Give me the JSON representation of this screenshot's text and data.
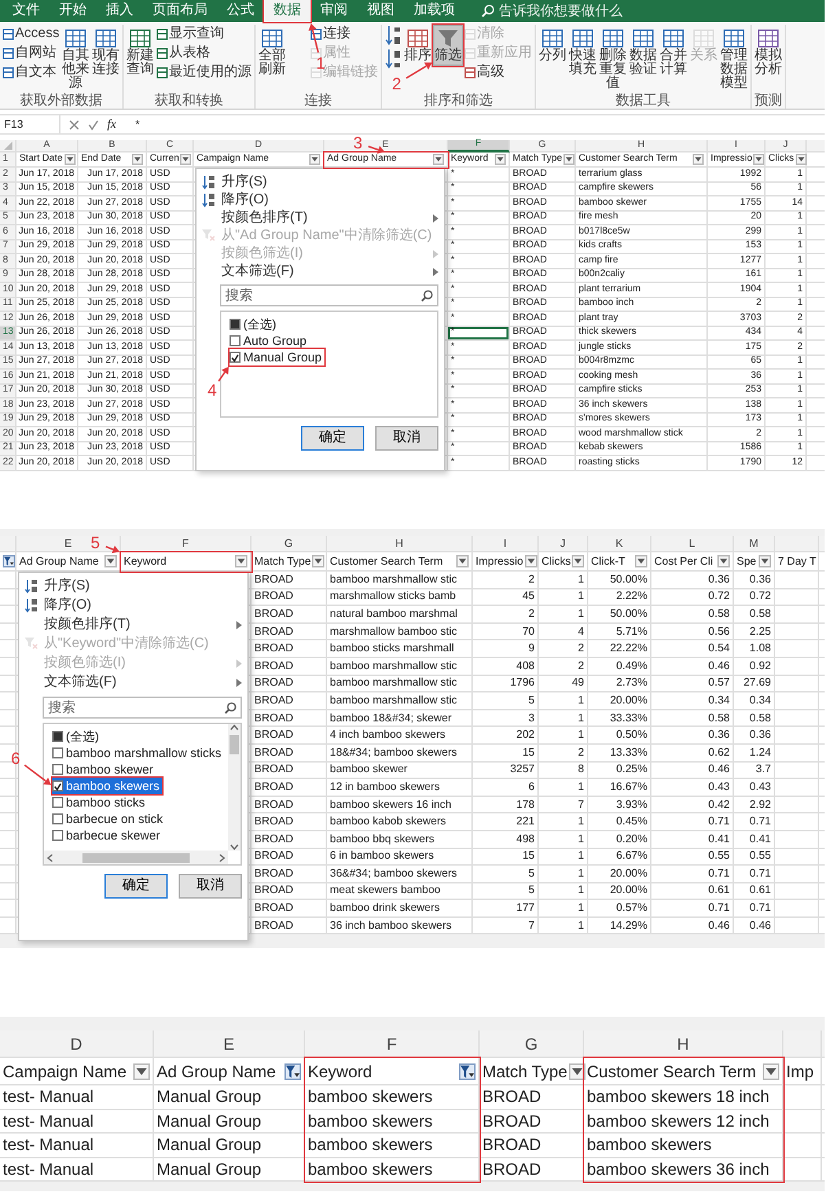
{
  "screenshot_1": {
    "ribbon_tabs": [
      {
        "label": "文件",
        "selected": false,
        "marked": false
      },
      {
        "label": "开始",
        "selected": false,
        "marked": false
      },
      {
        "label": "插入",
        "selected": false,
        "marked": false
      },
      {
        "label": "页面布局",
        "selected": false,
        "marked": false
      },
      {
        "label": "公式",
        "selected": false,
        "marked": false
      },
      {
        "label": "数据",
        "selected": true,
        "marked": true
      },
      {
        "label": "审阅",
        "selected": false,
        "marked": false
      },
      {
        "label": "视图",
        "selected": false,
        "marked": false
      },
      {
        "label": "加载项",
        "selected": false,
        "marked": false
      }
    ],
    "tell_me": "告诉我你想要做什么",
    "ribbon_groups": [
      {
        "label": "获取外部数据",
        "commands": [
          {
            "label": "Access",
            "kind": "small",
            "disabled": false,
            "selected": false,
            "marked": false
          },
          {
            "label": "自网站",
            "kind": "small",
            "disabled": false,
            "selected": false,
            "marked": false
          },
          {
            "label": "自文本",
            "kind": "small",
            "disabled": false,
            "selected": false,
            "marked": false
          },
          {
            "label": "自其他来源",
            "kind": "large",
            "disabled": false,
            "selected": false,
            "marked": false
          },
          {
            "label": "现有连接",
            "kind": "large",
            "disabled": false,
            "selected": false,
            "marked": false
          }
        ]
      },
      {
        "label": "获取和转换",
        "commands": [
          {
            "label": "新建查询",
            "kind": "large",
            "disabled": false,
            "selected": false,
            "marked": false
          },
          {
            "label": "显示查询",
            "kind": "small",
            "disabled": false,
            "selected": false,
            "marked": false
          },
          {
            "label": "从表格",
            "kind": "small",
            "disabled": false,
            "selected": false,
            "marked": false
          },
          {
            "label": "最近使用的源",
            "kind": "small",
            "disabled": false,
            "selected": false,
            "marked": false
          }
        ]
      },
      {
        "label": "连接",
        "commands": [
          {
            "label": "全部刷新",
            "kind": "large",
            "disabled": false,
            "selected": false,
            "marked": false
          },
          {
            "label": "连接",
            "kind": "small",
            "disabled": false,
            "selected": false,
            "marked": false
          },
          {
            "label": "属性",
            "kind": "small",
            "disabled": true,
            "selected": false,
            "marked": false
          },
          {
            "label": "编辑链接",
            "kind": "small",
            "disabled": true,
            "selected": false,
            "marked": false
          }
        ]
      },
      {
        "label": "排序和筛选",
        "commands": [
          {
            "kind": "sort-ascending",
            "disabled": false,
            "selected": false,
            "marked": false
          },
          {
            "kind": "sort-descending",
            "disabled": false,
            "selected": false,
            "marked": false
          },
          {
            "label": "排序",
            "kind": "large",
            "disabled": false,
            "selected": false,
            "marked": false
          },
          {
            "label": "筛选",
            "kind": "filter",
            "disabled": false,
            "selected": true,
            "marked": true
          },
          {
            "label": "清除",
            "kind": "small",
            "disabled": true,
            "selected": false,
            "marked": false
          },
          {
            "label": "重新应用",
            "kind": "small",
            "disabled": true,
            "selected": false,
            "marked": false
          },
          {
            "label": "高级",
            "kind": "small",
            "disabled": false,
            "selected": false,
            "marked": false
          }
        ]
      },
      {
        "label": "数据工具",
        "commands": [
          {
            "label": "分列",
            "kind": "large",
            "disabled": false,
            "selected": false,
            "marked": false
          },
          {
            "label": "快速填充",
            "kind": "large",
            "disabled": false,
            "selected": false,
            "marked": false
          },
          {
            "label": "删除重复值",
            "kind": "large",
            "disabled": false,
            "selected": false,
            "marked": false
          },
          {
            "label": "数据验证",
            "kind": "large",
            "disabled": false,
            "selected": false,
            "marked": false
          },
          {
            "label": "合并计算",
            "kind": "large",
            "disabled": false,
            "selected": false,
            "marked": false
          },
          {
            "label": "关系",
            "kind": "large",
            "disabled": true,
            "selected": false,
            "marked": false
          },
          {
            "label": "管理数据模型",
            "kind": "large",
            "disabled": false,
            "selected": false,
            "marked": false
          }
        ]
      },
      {
        "label": "预测",
        "commands": [
          {
            "label": "模拟分析",
            "kind": "large",
            "disabled": false,
            "selected": false,
            "marked": false
          }
        ]
      }
    ],
    "formula_bar": {
      "name_box": "F13",
      "function_label": "fx",
      "value": "*"
    },
    "columns": [
      {
        "letter": "A",
        "header": "Start Date",
        "filter_button": true,
        "filtered": false,
        "selected": false,
        "marked": false
      },
      {
        "letter": "B",
        "header": "End Date",
        "filter_button": true,
        "filtered": false,
        "selected": false,
        "marked": false
      },
      {
        "letter": "C",
        "header": "Curren",
        "filter_button": true,
        "filtered": false,
        "selected": false,
        "marked": false
      },
      {
        "letter": "D",
        "header": "Campaign Name",
        "filter_button": true,
        "filtered": false,
        "selected": false,
        "marked": false
      },
      {
        "letter": "E",
        "header": "Ad Group Name",
        "filter_button": true,
        "filtered": false,
        "selected": false,
        "marked": true
      },
      {
        "letter": "F",
        "header": "Keyword",
        "filter_button": true,
        "filtered": false,
        "selected": true,
        "marked": false
      },
      {
        "letter": "G",
        "header": "Match Type",
        "filter_button": true,
        "filtered": false,
        "selected": false,
        "marked": false
      },
      {
        "letter": "H",
        "header": "Customer Search Term",
        "filter_button": true,
        "filtered": false,
        "selected": false,
        "marked": false
      },
      {
        "letter": "I",
        "header": "Impressio",
        "filter_button": true,
        "filtered": false,
        "selected": false,
        "marked": false
      },
      {
        "letter": "J",
        "header": "Clicks",
        "filter_button": true,
        "filtered": false,
        "selected": false,
        "marked": false
      }
    ],
    "header_row_number": "1",
    "rows": [
      {
        "number": "2",
        "selected": false,
        "cells": [
          "Jun 17, 2018",
          "Jun 17, 2018",
          "USD",
          "",
          "",
          "*",
          "BROAD",
          "terrarium glass",
          "1992",
          "1"
        ]
      },
      {
        "number": "3",
        "selected": false,
        "cells": [
          "Jun 15, 2018",
          "Jun 15, 2018",
          "USD",
          "",
          "",
          "*",
          "BROAD",
          "campfire skewers",
          "56",
          "1"
        ]
      },
      {
        "number": "4",
        "selected": false,
        "cells": [
          "Jun 22, 2018",
          "Jun 27, 2018",
          "USD",
          "",
          "",
          "*",
          "BROAD",
          "bamboo skewer",
          "1755",
          "14"
        ]
      },
      {
        "number": "5",
        "selected": false,
        "cells": [
          "Jun 23, 2018",
          "Jun 30, 2018",
          "USD",
          "",
          "",
          "*",
          "BROAD",
          "fire mesh",
          "20",
          "1"
        ]
      },
      {
        "number": "6",
        "selected": false,
        "cells": [
          "Jun 16, 2018",
          "Jun 16, 2018",
          "USD",
          "",
          "",
          "*",
          "BROAD",
          "b017l8ce5w",
          "299",
          "1"
        ]
      },
      {
        "number": "7",
        "selected": false,
        "cells": [
          "Jun 29, 2018",
          "Jun 29, 2018",
          "USD",
          "",
          "",
          "*",
          "BROAD",
          "kids crafts",
          "153",
          "1"
        ]
      },
      {
        "number": "8",
        "selected": false,
        "cells": [
          "Jun 20, 2018",
          "Jun 20, 2018",
          "USD",
          "",
          "",
          "*",
          "BROAD",
          "camp fire",
          "1277",
          "1"
        ]
      },
      {
        "number": "9",
        "selected": false,
        "cells": [
          "Jun 28, 2018",
          "Jun 28, 2018",
          "USD",
          "",
          "",
          "*",
          "BROAD",
          "b00n2caliy",
          "161",
          "1"
        ]
      },
      {
        "number": "10",
        "selected": false,
        "cells": [
          "Jun 20, 2018",
          "Jun 29, 2018",
          "USD",
          "",
          "",
          "*",
          "BROAD",
          "plant terrarium",
          "1904",
          "1"
        ]
      },
      {
        "number": "11",
        "selected": false,
        "cells": [
          "Jun 25, 2018",
          "Jun 25, 2018",
          "USD",
          "",
          "",
          "*",
          "BROAD",
          "bamboo inch",
          "2",
          "1"
        ]
      },
      {
        "number": "12",
        "selected": false,
        "cells": [
          "Jun 26, 2018",
          "Jun 29, 2018",
          "USD",
          "",
          "",
          "*",
          "BROAD",
          "plant tray",
          "3703",
          "2"
        ]
      },
      {
        "number": "13",
        "selected": true,
        "cells": [
          "Jun 26, 2018",
          "Jun 26, 2018",
          "USD",
          "",
          "",
          "*",
          "BROAD",
          "thick skewers",
          "434",
          "4"
        ]
      },
      {
        "number": "14",
        "selected": false,
        "cells": [
          "Jun 13, 2018",
          "Jun 13, 2018",
          "USD",
          "",
          "",
          "*",
          "BROAD",
          "jungle sticks",
          "175",
          "2"
        ]
      },
      {
        "number": "15",
        "selected": false,
        "cells": [
          "Jun 27, 2018",
          "Jun 27, 2018",
          "USD",
          "",
          "",
          "*",
          "BROAD",
          "b004r8mzmc",
          "65",
          "1"
        ]
      },
      {
        "number": "16",
        "selected": false,
        "cells": [
          "Jun 21, 2018",
          "Jun 21, 2018",
          "USD",
          "",
          "",
          "*",
          "BROAD",
          "cooking mesh",
          "36",
          "1"
        ]
      },
      {
        "number": "17",
        "selected": false,
        "cells": [
          "Jun 20, 2018",
          "Jun 30, 2018",
          "USD",
          "",
          "",
          "*",
          "BROAD",
          "campfire sticks",
          "253",
          "1"
        ]
      },
      {
        "number": "18",
        "selected": false,
        "cells": [
          "Jun 23, 2018",
          "Jun 27, 2018",
          "USD",
          "",
          "",
          "*",
          "BROAD",
          "36 inch skewers",
          "138",
          "1"
        ]
      },
      {
        "number": "19",
        "selected": false,
        "cells": [
          "Jun 29, 2018",
          "Jun 29, 2018",
          "USD",
          "",
          "",
          "*",
          "BROAD",
          "s'mores skewers",
          "173",
          "1"
        ]
      },
      {
        "number": "20",
        "selected": false,
        "cells": [
          "Jun 20, 2018",
          "Jun 20, 2018",
          "USD",
          "",
          "",
          "*",
          "BROAD",
          "wood marshmallow stick",
          "2",
          "1"
        ]
      },
      {
        "number": "21",
        "selected": false,
        "cells": [
          "Jun 23, 2018",
          "Jun 23, 2018",
          "USD",
          "",
          "",
          "*",
          "BROAD",
          "kebab skewers",
          "1586",
          "1"
        ]
      },
      {
        "number": "22",
        "selected": false,
        "cells": [
          "Jun 20, 2018",
          "Jun 20, 2018",
          "USD",
          "",
          "",
          "*",
          "BROAD",
          "roasting sticks",
          "1790",
          "12"
        ]
      }
    ],
    "filter_menu": {
      "items": [
        {
          "label": "升序(S)",
          "kind": "sort-ascending",
          "disabled": false,
          "submenu": false
        },
        {
          "label": "降序(O)",
          "kind": "sort-descending",
          "disabled": false,
          "submenu": false
        },
        {
          "label": "按颜色排序(T)",
          "kind": "plain",
          "disabled": false,
          "submenu": true
        },
        {
          "label": "从\"Ad Group Name\"中清除筛选(C)",
          "kind": "clear-filter",
          "disabled": true,
          "submenu": false
        },
        {
          "label": "按颜色筛选(I)",
          "kind": "plain",
          "disabled": true,
          "submenu": true
        },
        {
          "label": "文本筛选(F)",
          "kind": "plain",
          "disabled": false,
          "submenu": true
        }
      ],
      "search_placeholder": "搜索",
      "options": [
        {
          "label": "(全选)",
          "checked": false,
          "indeterminate": true,
          "selected": false,
          "marked": false
        },
        {
          "label": "Auto Group",
          "checked": false,
          "indeterminate": false,
          "selected": false,
          "marked": false
        },
        {
          "label": "Manual Group",
          "checked": true,
          "indeterminate": false,
          "selected": false,
          "marked": true
        }
      ],
      "buttons": [
        "确定",
        "取消"
      ]
    },
    "callouts": [
      "1",
      "2",
      "3",
      "4"
    ]
  },
  "screenshot_2": {
    "columns": [
      {
        "filter_button": true,
        "filtered": true,
        "marked": false
      },
      {
        "letter": "E",
        "header": "Ad Group Name",
        "filter_button": true,
        "filtered": false,
        "marked": false
      },
      {
        "letter": "F",
        "header": "Keyword",
        "filter_button": true,
        "filtered": false,
        "marked": true
      },
      {
        "letter": "G",
        "header": "Match Type",
        "filter_button": true,
        "filtered": false,
        "marked": false
      },
      {
        "letter": "H",
        "header": "Customer Search Term",
        "filter_button": true,
        "filtered": false,
        "marked": false
      },
      {
        "letter": "I",
        "header": "Impressio",
        "filter_button": true,
        "filtered": false,
        "marked": false
      },
      {
        "letter": "J",
        "header": "Clicks",
        "filter_button": true,
        "filtered": false,
        "marked": false
      },
      {
        "letter": "K",
        "header": "Click-T",
        "filter_button": true,
        "filtered": false,
        "marked": false
      },
      {
        "letter": "L",
        "header": "Cost Per Cli",
        "filter_button": true,
        "filtered": false,
        "marked": false
      },
      {
        "letter": "M",
        "header": "Spe",
        "filter_button": true,
        "filtered": false,
        "marked": false
      },
      {
        "header": "7 Day T",
        "filter_button": false,
        "marked": false
      }
    ],
    "rows": [
      {
        "cells": [
          "",
          "",
          "",
          "BROAD",
          "bamboo marshmallow stic",
          "2",
          "1",
          "50.00%",
          "0.36",
          "0.36"
        ]
      },
      {
        "cells": [
          "",
          "",
          "",
          "BROAD",
          "marshmallow sticks bamb",
          "45",
          "1",
          "2.22%",
          "0.72",
          "0.72"
        ]
      },
      {
        "cells": [
          "",
          "",
          "",
          "BROAD",
          "natural bamboo marshmal",
          "2",
          "1",
          "50.00%",
          "0.58",
          "0.58"
        ]
      },
      {
        "cells": [
          "",
          "",
          "",
          "BROAD",
          "marshmallow bamboo stic",
          "70",
          "4",
          "5.71%",
          "0.56",
          "2.25"
        ]
      },
      {
        "cells": [
          "",
          "",
          "",
          "BROAD",
          "bamboo sticks marshmall",
          "9",
          "2",
          "22.22%",
          "0.54",
          "1.08"
        ]
      },
      {
        "cells": [
          "",
          "",
          "",
          "BROAD",
          "bamboo marshmallow stic",
          "408",
          "2",
          "0.49%",
          "0.46",
          "0.92"
        ]
      },
      {
        "cells": [
          "",
          "",
          "",
          "BROAD",
          "bamboo marshmallow stic",
          "1796",
          "49",
          "2.73%",
          "0.57",
          "27.69"
        ]
      },
      {
        "cells": [
          "",
          "",
          "",
          "BROAD",
          "bamboo marshmallow stic",
          "5",
          "1",
          "20.00%",
          "0.34",
          "0.34"
        ]
      },
      {
        "cells": [
          "",
          "",
          "",
          "BROAD",
          "bamboo 18&#34; skewer",
          "3",
          "1",
          "33.33%",
          "0.58",
          "0.58"
        ]
      },
      {
        "cells": [
          "",
          "",
          "",
          "BROAD",
          "4 inch bamboo skewers",
          "202",
          "1",
          "0.50%",
          "0.36",
          "0.36"
        ]
      },
      {
        "cells": [
          "",
          "",
          "",
          "BROAD",
          "18&#34; bamboo skewers",
          "15",
          "2",
          "13.33%",
          "0.62",
          "1.24"
        ]
      },
      {
        "cells": [
          "",
          "",
          "",
          "BROAD",
          "bamboo skewer",
          "3257",
          "8",
          "0.25%",
          "0.46",
          "3.7"
        ]
      },
      {
        "cells": [
          "",
          "",
          "",
          "BROAD",
          "12 in bamboo skewers",
          "6",
          "1",
          "16.67%",
          "0.43",
          "0.43"
        ]
      },
      {
        "cells": [
          "",
          "",
          "",
          "BROAD",
          "bamboo skewers 16 inch",
          "178",
          "7",
          "3.93%",
          "0.42",
          "2.92"
        ]
      },
      {
        "cells": [
          "",
          "",
          "",
          "BROAD",
          "bamboo kabob skewers",
          "221",
          "1",
          "0.45%",
          "0.71",
          "0.71"
        ]
      },
      {
        "cells": [
          "",
          "",
          "",
          "BROAD",
          "bamboo bbq skewers",
          "498",
          "1",
          "0.20%",
          "0.41",
          "0.41"
        ]
      },
      {
        "cells": [
          "",
          "",
          "",
          "BROAD",
          "6 in bamboo skewers",
          "15",
          "1",
          "6.67%",
          "0.55",
          "0.55"
        ]
      },
      {
        "cells": [
          "",
          "",
          "",
          "BROAD",
          "36&#34; bamboo skewers",
          "5",
          "1",
          "20.00%",
          "0.71",
          "0.71"
        ]
      },
      {
        "cells": [
          "",
          "",
          "",
          "BROAD",
          "meat skewers bamboo",
          "5",
          "1",
          "20.00%",
          "0.61",
          "0.61"
        ]
      },
      {
        "cells": [
          "",
          "",
          "",
          "BROAD",
          "bamboo drink skewers",
          "177",
          "1",
          "0.57%",
          "0.71",
          "0.71"
        ]
      },
      {
        "cells": [
          "",
          "",
          "",
          "BROAD",
          "36 inch bamboo skewers",
          "7",
          "1",
          "14.29%",
          "0.46",
          "0.46"
        ]
      }
    ],
    "filter_menu": {
      "items": [
        {
          "label": "升序(S)",
          "kind": "sort-ascending",
          "disabled": false,
          "submenu": false
        },
        {
          "label": "降序(O)",
          "kind": "sort-descending",
          "disabled": false,
          "submenu": false
        },
        {
          "label": "按颜色排序(T)",
          "kind": "plain",
          "disabled": false,
          "submenu": true
        },
        {
          "label": "从\"Keyword\"中清除筛选(C)",
          "kind": "clear-filter",
          "disabled": true,
          "submenu": false
        },
        {
          "label": "按颜色筛选(I)",
          "kind": "plain",
          "disabled": true,
          "submenu": true
        },
        {
          "label": "文本筛选(F)",
          "kind": "plain",
          "disabled": false,
          "submenu": true
        }
      ],
      "search_placeholder": "搜索",
      "options": [
        {
          "label": "(全选)",
          "checked": false,
          "indeterminate": true,
          "selected": false,
          "marked": false
        },
        {
          "label": "bamboo marshmallow sticks",
          "checked": false,
          "indeterminate": false,
          "selected": false,
          "marked": false
        },
        {
          "label": "bamboo skewer",
          "checked": false,
          "indeterminate": false,
          "selected": false,
          "marked": false
        },
        {
          "label": "bamboo skewers",
          "checked": true,
          "indeterminate": false,
          "selected": true,
          "marked": true
        },
        {
          "label": "bamboo sticks",
          "checked": false,
          "indeterminate": false,
          "selected": false,
          "marked": false
        },
        {
          "label": "barbecue on stick",
          "checked": false,
          "indeterminate": false,
          "selected": false,
          "marked": false
        },
        {
          "label": "barbecue skewer",
          "checked": false,
          "indeterminate": false,
          "selected": false,
          "marked": false
        }
      ],
      "buttons": [
        "确定",
        "取消"
      ]
    },
    "callouts": [
      "5",
      "6"
    ]
  },
  "screenshot_3": {
    "columns": [
      {
        "letter": "D",
        "header": "Campaign Name",
        "filter_button": true,
        "filtered": false,
        "framed": false
      },
      {
        "letter": "E",
        "header": "Ad Group Name",
        "filter_button": true,
        "filtered": true,
        "framed": false
      },
      {
        "letter": "F",
        "header": "Keyword",
        "filter_button": true,
        "filtered": true,
        "framed": true
      },
      {
        "letter": "G",
        "header": "Match Type",
        "filter_button": true,
        "filtered": false,
        "framed": false
      },
      {
        "letter": "H",
        "header": "Customer Search Term",
        "filter_button": true,
        "filtered": false,
        "framed": true
      },
      {
        "header": "Imp",
        "filter_button": false,
        "framed": false
      }
    ],
    "rows": [
      {
        "cells": [
          "test- Manual",
          "Manual Group",
          "bamboo skewers",
          "BROAD",
          "bamboo skewers 18 inch"
        ]
      },
      {
        "cells": [
          "test- Manual",
          "Manual Group",
          "bamboo skewers",
          "BROAD",
          "bamboo skewers 12 inch"
        ]
      },
      {
        "cells": [
          "test- Manual",
          "Manual Group",
          "bamboo skewers",
          "BROAD",
          "bamboo skewers"
        ]
      },
      {
        "cells": [
          "test- Manual",
          "Manual Group",
          "bamboo skewers",
          "BROAD",
          "bamboo skewers 36 inch"
        ]
      }
    ]
  }
}
